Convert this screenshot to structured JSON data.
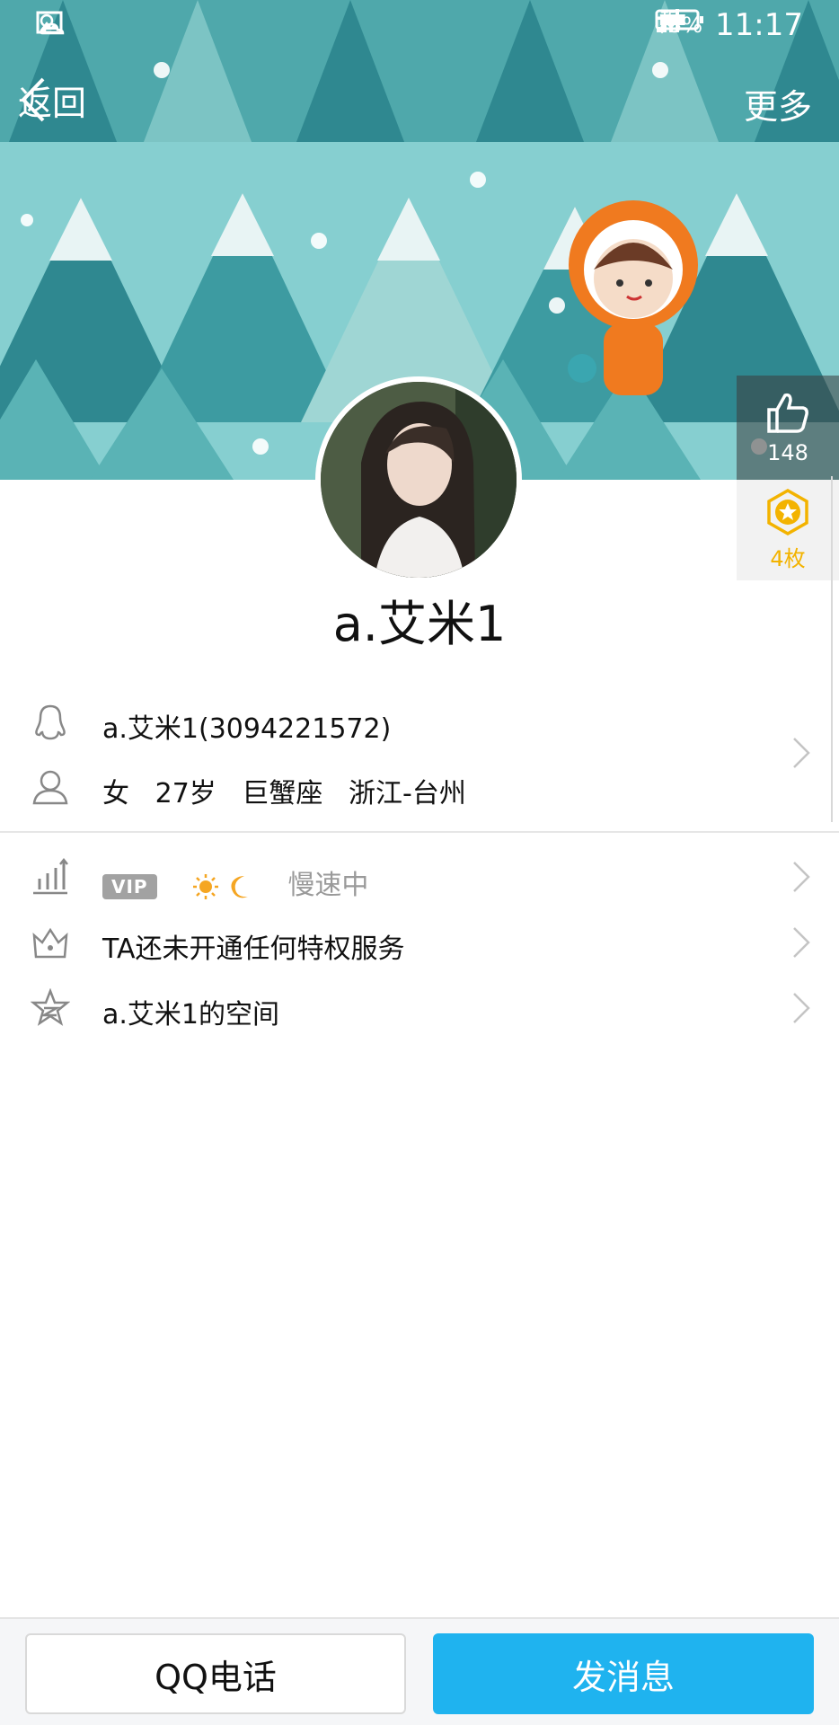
{
  "status_bar": {
    "network": "LTE",
    "battery_percent": "73%",
    "battery_level": 0.73,
    "time": "11:17",
    "icons": [
      "image-icon",
      "weather-icon",
      "lte-icon",
      "signal-icon",
      "battery-icon"
    ]
  },
  "nav": {
    "back_label": "返回",
    "more_label": "更多"
  },
  "side": {
    "likes": "148",
    "medals": "4枚"
  },
  "profile": {
    "name": "a.艾米1"
  },
  "info": {
    "qq_line": "a.艾米1(3094221572)",
    "gender": "女",
    "age": "27岁",
    "zodiac": "巨蟹座",
    "location": "浙江-台州"
  },
  "level": {
    "vip_label": "VIP",
    "speed_status": "慢速中"
  },
  "privilege": {
    "text": "TA还未开通任何特权服务"
  },
  "space": {
    "text": "a.艾米1的空间"
  },
  "bottom": {
    "call_label": "QQ电话",
    "message_label": "发消息"
  },
  "colors": {
    "banner_bg": "#86cfd0",
    "tree_dark": "#2f8890",
    "tree_mid": "#3d9ba1",
    "primary_button": "#1fb3ef",
    "medal_gold": "#f3b300"
  }
}
